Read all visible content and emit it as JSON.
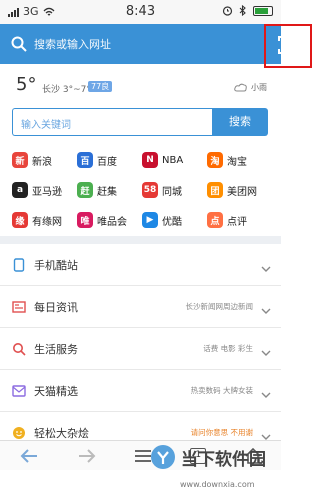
{
  "status": {
    "carrier": "3G",
    "time": "8:43"
  },
  "search": {
    "placeholder": "搜索或输入网址"
  },
  "weather": {
    "temp": "5°",
    "city_range": "长沙 3°~7°",
    "aqi": "77良",
    "condition": "小雨"
  },
  "keyword": {
    "placeholder": "输入关键词",
    "button": "搜索"
  },
  "shortcuts": [
    {
      "label": "新浪",
      "color": "#e8453c",
      "glyph": "新"
    },
    {
      "label": "百度",
      "color": "#2b6fd6",
      "glyph": "百"
    },
    {
      "label": "NBA",
      "color": "#c8102e",
      "glyph": "N"
    },
    {
      "label": "淘宝",
      "color": "#ff6a00",
      "glyph": "淘"
    },
    {
      "label": "亚马逊",
      "color": "#222222",
      "glyph": "a"
    },
    {
      "label": "赶集",
      "color": "#4caf50",
      "glyph": "赶"
    },
    {
      "label": "同城",
      "color": "#e53935",
      "glyph": "58"
    },
    {
      "label": "美团网",
      "color": "#ff8f00",
      "glyph": "团"
    },
    {
      "label": "有缘网",
      "color": "#e53935",
      "glyph": "缘"
    },
    {
      "label": "唯品会",
      "color": "#d81b60",
      "glyph": "唯"
    },
    {
      "label": "优酷",
      "color": "#1e88e5",
      "glyph": "▶"
    },
    {
      "label": "点评",
      "color": "#ff7043",
      "glyph": "点"
    }
  ],
  "rows": [
    {
      "label": "手机酷站",
      "extra": "",
      "color": "#3a91d6"
    },
    {
      "label": "每日资讯",
      "extra": "长沙新闻网周边新闻",
      "color": "#e05050"
    },
    {
      "label": "生活服务",
      "extra": "话费 电影 彩生",
      "color": "#e05050"
    },
    {
      "label": "天猫精选",
      "extra": "热卖数码 大牌女装",
      "color": "#8c6be0"
    },
    {
      "label": "轻松大杂烩",
      "extra": "请问你意思 不用谢",
      "color": "#f0b020"
    }
  ],
  "watermark": {
    "name": "当下软件园",
    "url": "www.downxia.com"
  },
  "tab_count": "1"
}
